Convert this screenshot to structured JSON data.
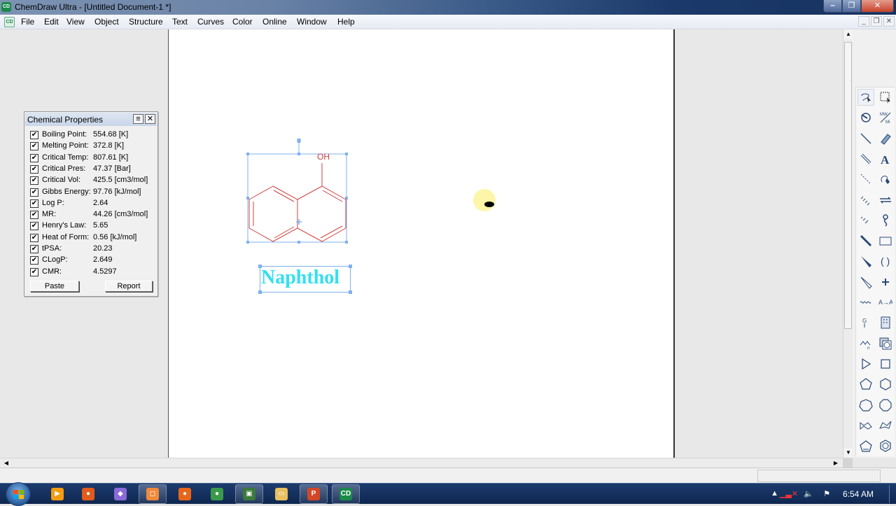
{
  "window": {
    "title": "ChemDraw Ultra - [Untitled Document-1 *]",
    "app_icon": "chemdraw-icon",
    "controls": [
      "minimize",
      "maximize",
      "close"
    ]
  },
  "menubar": {
    "items": [
      {
        "label": "File"
      },
      {
        "label": "Edit"
      },
      {
        "label": "View"
      },
      {
        "label": "Object"
      },
      {
        "label": "Structure"
      },
      {
        "label": "Text"
      },
      {
        "label": "Curves"
      },
      {
        "label": "Color"
      },
      {
        "label": "Online"
      },
      {
        "label": "Window"
      },
      {
        "label": "Help"
      }
    ],
    "mdi_controls": [
      "minimize",
      "restore",
      "close"
    ]
  },
  "properties_panel": {
    "title": "Chemical Properties",
    "rows": [
      {
        "label": "Boiling Point:",
        "value": "554.68 [K]",
        "checked": true
      },
      {
        "label": "Melting Point:",
        "value": "372.8 [K]",
        "checked": true
      },
      {
        "label": "Critical Temp:",
        "value": "807.61 [K]",
        "checked": true
      },
      {
        "label": "Critical Pres:",
        "value": "47.37 [Bar]",
        "checked": true
      },
      {
        "label": "Critical Vol:",
        "value": "425.5 [cm3/mol]",
        "checked": true
      },
      {
        "label": "Gibbs Energy:",
        "value": "97.76 [kJ/mol]",
        "checked": true
      },
      {
        "label": "Log P:",
        "value": "2.64",
        "checked": true
      },
      {
        "label": "MR:",
        "value": "44.26 [cm3/mol]",
        "checked": true
      },
      {
        "label": "Henry's Law:",
        "value": "5.65",
        "checked": true
      },
      {
        "label": "Heat of Form:",
        "value": "0.56 [kJ/mol]",
        "checked": true
      },
      {
        "label": "tPSA:",
        "value": "20.23",
        "checked": true
      },
      {
        "label": "CLogP:",
        "value": "2.649",
        "checked": true
      },
      {
        "label": "CMR:",
        "value": "4.5297",
        "checked": true
      }
    ],
    "paste_label": "Paste",
    "report_label": "Report",
    "checkmark": "✔",
    "menu_glyph": "≡",
    "close_glyph": "✕"
  },
  "canvas": {
    "molecule": {
      "name": "1-naphthol",
      "substituent_label": "OH",
      "color": "#d04040"
    },
    "caption": {
      "text": "Naphthol",
      "color": "#33e0ee"
    },
    "selection_color": "#7fb0ee"
  },
  "tools": [
    "lasso-tool",
    "marquee-tool",
    "structure-perspective-tool",
    "mass-fragmentation-tool",
    "solid-bond-tool",
    "eraser-tool",
    "multiple-bond-tool",
    "text-tool",
    "dashed-bond-tool",
    "pen-tool",
    "hashed-bond-tool",
    "arrow-tool",
    "hashed-wedge-tool",
    "orbital-tool",
    "bold-bond-tool",
    "drawing-elements-tool",
    "wedge-bond-tool",
    "brackets-tool",
    "hollow-wedge-tool",
    "chemical-symbols-tool",
    "wavy-bond-tool",
    "query-tool",
    "template-tool",
    "tlc-plate-tool",
    "repeat-unit-tool",
    "templates-gallery-tool",
    "cyclopropane-tool",
    "cyclobutane-tool",
    "cyclopentane-tool",
    "cyclohexane-tool",
    "cycloheptane-tool",
    "cyclooctane-tool",
    "chair-cyclohexane-1-tool",
    "chair-cyclohexane-2-tool",
    "cyclopentadiene-tool",
    "benzene-tool"
  ],
  "taskbar": {
    "items": [
      {
        "name": "media-player",
        "glyph": "▶",
        "color": "#f39c12"
      },
      {
        "name": "paint-app",
        "glyph": "●",
        "color": "#e25b1b"
      },
      {
        "name": "prism-app",
        "glyph": "◆",
        "color": "#8a6ad8"
      },
      {
        "name": "screen-recorder",
        "glyph": "◻",
        "color": "#f08a3a"
      },
      {
        "name": "firefox",
        "glyph": "●",
        "color": "#e8661a"
      },
      {
        "name": "chrome",
        "glyph": "●",
        "color": "#3a9a4a"
      },
      {
        "name": "system-monitor",
        "glyph": "▣",
        "color": "#3a7a3a"
      },
      {
        "name": "file-explorer",
        "glyph": "▭",
        "color": "#e8c060"
      },
      {
        "name": "powerpoint",
        "glyph": "P",
        "color": "#d24726"
      },
      {
        "name": "chemdraw",
        "glyph": "CD",
        "color": "#1a8a4a"
      }
    ],
    "tray": {
      "show_hidden": "▲",
      "network": "network-disconnected-icon",
      "volume": "volume-icon",
      "action_center": "action-center-flag-icon",
      "clock": "6:54 AM"
    }
  }
}
